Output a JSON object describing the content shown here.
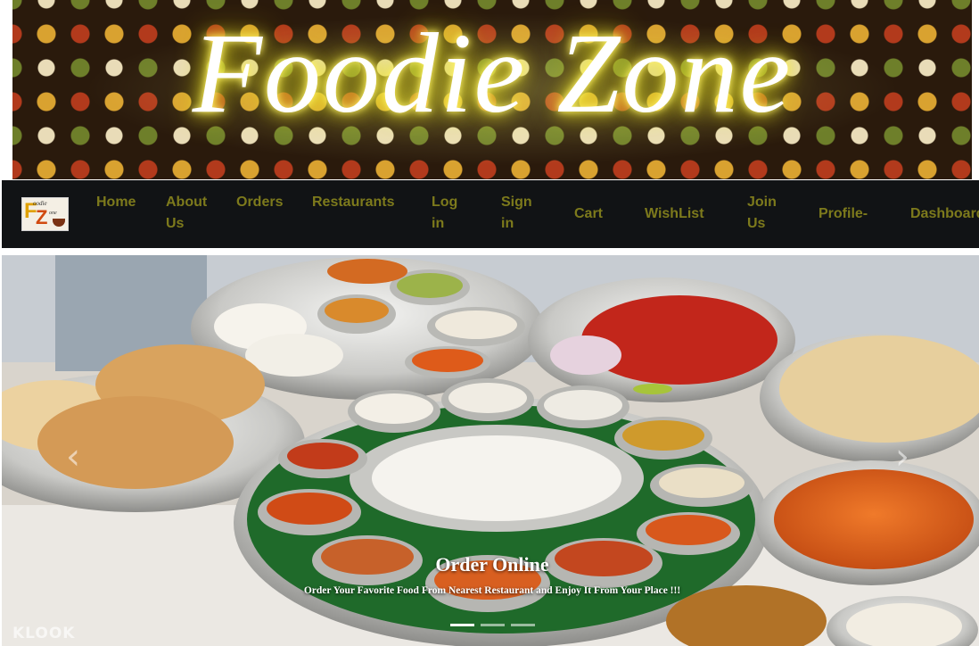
{
  "banner": {
    "title": "Foodie Zone"
  },
  "logo": {
    "initial_f": "F",
    "initial_z": "Z",
    "word_top": "oodie",
    "word_bottom": "one"
  },
  "nav": {
    "home": "Home",
    "about_line1": "About",
    "about_line2": "Us",
    "orders": "Orders",
    "restaurants": "Restaurants",
    "login_line1": "Log",
    "login_line2": "in",
    "signin_line1": "Sign",
    "signin_line2": "in",
    "cart": "Cart",
    "wishlist": "WishList",
    "join_line1": "Join",
    "join_line2": "Us",
    "profile": "Profile-",
    "dashboard": "Dashboard"
  },
  "carousel": {
    "prev_glyph": "‹",
    "next_glyph": "›",
    "caption_title": "Order Online",
    "caption_text": "Order Your Favorite Food From Nearest Restaurant and Enjoy It From Your Place !!!",
    "active_slide": 1,
    "slide_count": 3
  },
  "watermark": "KLOOK",
  "colors": {
    "nav_bg": "#111315",
    "nav_text": "#7d7a1c",
    "title_glow": "#f2e83b"
  }
}
